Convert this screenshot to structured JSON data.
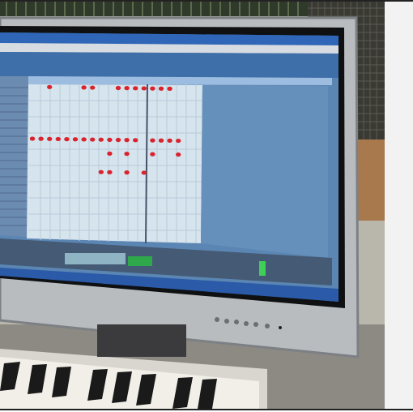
{
  "scene": {
    "subject": "monitor-with-sequencer-and-keyboard"
  },
  "note_grid": {
    "rows": [
      {
        "y": 0,
        "notes": [
          2,
          6,
          7,
          10,
          11,
          12,
          13,
          14,
          15,
          16
        ]
      },
      {
        "y": 1,
        "notes": [
          0,
          1,
          2,
          3,
          4,
          5,
          6,
          7,
          8,
          9,
          10,
          11,
          12,
          14,
          15,
          16,
          17
        ]
      },
      {
        "y": 2,
        "notes": [
          9,
          11,
          14,
          17
        ]
      },
      {
        "y": 3,
        "notes": [
          8,
          9,
          11,
          13
        ]
      }
    ]
  }
}
